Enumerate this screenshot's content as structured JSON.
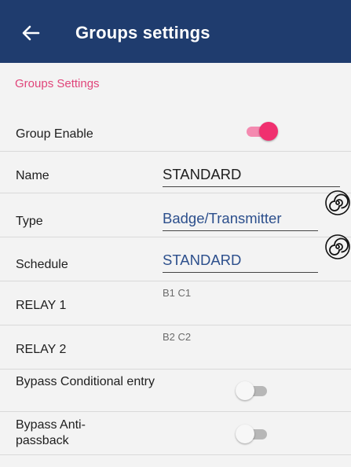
{
  "appbar": {
    "back_icon": "arrow-back-icon",
    "title": "Groups settings",
    "background": "#1f3c6e"
  },
  "section": {
    "title": "Groups Settings",
    "title_color": "#e0457a"
  },
  "group_enable": {
    "label": "Group Enable",
    "enabled": true
  },
  "name": {
    "label": "Name",
    "value": "STANDARD"
  },
  "type": {
    "label": "Type",
    "value": "Badge/Transmitter",
    "value_color": "#2c4f8c",
    "icon": "spiral-icon"
  },
  "schedule": {
    "label": "Schedule",
    "value": "STANDARD",
    "value_color": "#2c4f8c",
    "icon": "spiral-icon"
  },
  "relay1": {
    "label": "RELAY 1",
    "value": "B1 C1"
  },
  "relay2": {
    "label": "RELAY 2",
    "value": "B2 C2"
  },
  "bypass_conditional": {
    "label": "Bypass Conditional entry",
    "enabled": false
  },
  "bypass_antipassback": {
    "label": "Bypass Anti-passback",
    "enabled": false
  },
  "colors": {
    "accent": "#f0306f",
    "accent_track": "#f48ab0"
  }
}
